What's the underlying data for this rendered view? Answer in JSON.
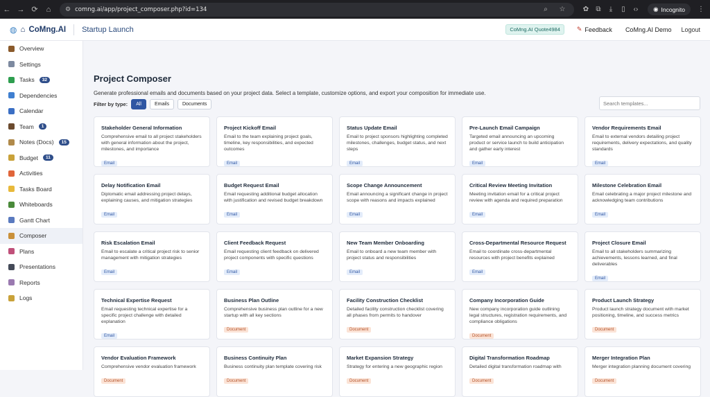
{
  "browser": {
    "url": "comng.ai/app/project_composer.php?id=134",
    "incognito_label": "Incognito"
  },
  "header": {
    "logo_text": "CoMng.AI",
    "project_name": "Startup Launch",
    "quota_badge": "CoMng.AI Quote4984",
    "feedback_label": "Feedback",
    "user_label": "CoMng.AI Demo",
    "logout_label": "Logout"
  },
  "sidebar": {
    "items": [
      {
        "label": "Overview",
        "icon": "briefcase-icon",
        "color": "#8a5a2b"
      },
      {
        "label": "Settings",
        "icon": "gear-icon",
        "color": "#7d8aa0"
      },
      {
        "label": "Tasks",
        "icon": "check-icon",
        "color": "#2e9e4f",
        "badge": "32"
      },
      {
        "label": "Dependencies",
        "icon": "link-icon",
        "color": "#3f7fd0"
      },
      {
        "label": "Calendar",
        "icon": "calendar-icon",
        "color": "#3b6fc4"
      },
      {
        "label": "Team",
        "icon": "people-icon",
        "color": "#6b4a2e",
        "badge": "1"
      },
      {
        "label": "Notes (Docs)",
        "icon": "notes-icon",
        "color": "#b08a4a",
        "badge": "15"
      },
      {
        "label": "Budget",
        "icon": "money-icon",
        "color": "#c9a23a",
        "badge": "11"
      },
      {
        "label": "Activities",
        "icon": "fire-icon",
        "color": "#e0653a"
      },
      {
        "label": "Tasks Board",
        "icon": "board-icon",
        "color": "#e8b93b"
      },
      {
        "label": "Whiteboards",
        "icon": "whiteboard-icon",
        "color": "#4a8a3a"
      },
      {
        "label": "Gantt Chart",
        "icon": "chart-icon",
        "color": "#5a7abf"
      },
      {
        "label": "Composer",
        "icon": "composer-icon",
        "color": "#c9903a"
      },
      {
        "label": "Plans",
        "icon": "plans-icon",
        "color": "#c0507a"
      },
      {
        "label": "Presentations",
        "icon": "presentation-icon",
        "color": "#444a58"
      },
      {
        "label": "Reports",
        "icon": "reports-icon",
        "color": "#9a7ab0"
      },
      {
        "label": "Logs",
        "icon": "logs-icon",
        "color": "#c9a23a"
      }
    ]
  },
  "main": {
    "title": "Project Composer",
    "description": "Generate professional emails and documents based on your project data. Select a template, customize options, and export your composition for immediate use.",
    "filter_label": "Filter by type:",
    "filters": [
      "All",
      "Emails",
      "Documents"
    ],
    "search_placeholder": "Search templates...",
    "cards": [
      {
        "title": "Stakeholder General Information",
        "desc": "Comprehensive email to all project stakeholders with general information about the project, milestones, and importance",
        "tag": "Email"
      },
      {
        "title": "Project Kickoff Email",
        "desc": "Email to the team explaining project goals, timeline, key responsibilities, and expected outcomes",
        "tag": "Email"
      },
      {
        "title": "Status Update Email",
        "desc": "Email to project sponsors highlighting completed milestones, challenges, budget status, and next steps",
        "tag": "Email"
      },
      {
        "title": "Pre-Launch Email Campaign",
        "desc": "Targeted email announcing an upcoming product or service launch to build anticipation and gather early interest",
        "tag": "Email"
      },
      {
        "title": "Vendor Requirements Email",
        "desc": "Email to external vendors detailing project requirements, delivery expectations, and quality standards",
        "tag": "Email"
      },
      {
        "title": "Delay Notification Email",
        "desc": "Diplomatic email addressing project delays, explaining causes, and mitigation strategies",
        "tag": "Email"
      },
      {
        "title": "Budget Request Email",
        "desc": "Email requesting additional budget allocation with justification and revised budget breakdown",
        "tag": "Email"
      },
      {
        "title": "Scope Change Announcement",
        "desc": "Email announcing a significant change in project scope with reasons and impacts explained",
        "tag": "Email"
      },
      {
        "title": "Critical Review Meeting Invitation",
        "desc": "Meeting invitation email for a critical project review with agenda and required preparation",
        "tag": "Email"
      },
      {
        "title": "Milestone Celebration Email",
        "desc": "Email celebrating a major project milestone and acknowledging team contributions",
        "tag": "Email"
      },
      {
        "title": "Risk Escalation Email",
        "desc": "Email to escalate a critical project risk to senior management with mitigation strategies",
        "tag": "Email"
      },
      {
        "title": "Client Feedback Request",
        "desc": "Email requesting client feedback on delivered project components with specific questions",
        "tag": "Email"
      },
      {
        "title": "New Team Member Onboarding",
        "desc": "Email to onboard a new team member with project status and responsibilities",
        "tag": "Email"
      },
      {
        "title": "Cross-Departmental Resource Request",
        "desc": "Email to coordinate cross-departmental resources with project benefits explained",
        "tag": "Email"
      },
      {
        "title": "Project Closure Email",
        "desc": "Email to all stakeholders summarizing achievements, lessons learned, and final deliverables",
        "tag": "Email"
      },
      {
        "title": "Technical Expertise Request",
        "desc": "Email requesting technical expertise for a specific project challenge with detailed explanation",
        "tag": "Email"
      },
      {
        "title": "Business Plan Outline",
        "desc": "Comprehensive business plan outline for a new startup with all key sections",
        "tag": "Document"
      },
      {
        "title": "Facility Construction Checklist",
        "desc": "Detailed facility construction checklist covering all phases from permits to handover",
        "tag": "Document"
      },
      {
        "title": "Company Incorporation Guide",
        "desc": "New company incorporation guide outlining legal structures, registration requirements, and compliance obligations",
        "tag": "Document"
      },
      {
        "title": "Product Launch Strategy",
        "desc": "Product launch strategy document with market positioning, timeline, and success metrics",
        "tag": "Document"
      },
      {
        "title": "Vendor Evaluation Framework",
        "desc": "Comprehensive vendor evaluation framework",
        "tag": "Document"
      },
      {
        "title": "Business Continuity Plan",
        "desc": "Business continuity plan template covering risk",
        "tag": "Document"
      },
      {
        "title": "Market Expansion Strategy",
        "desc": "Strategy for entering a new geographic region",
        "tag": "Document"
      },
      {
        "title": "Digital Transformation Roadmap",
        "desc": "Detailed digital transformation roadmap with",
        "tag": "Document"
      },
      {
        "title": "Merger Integration Plan",
        "desc": "Merger integration planning document covering",
        "tag": "Document"
      }
    ]
  }
}
